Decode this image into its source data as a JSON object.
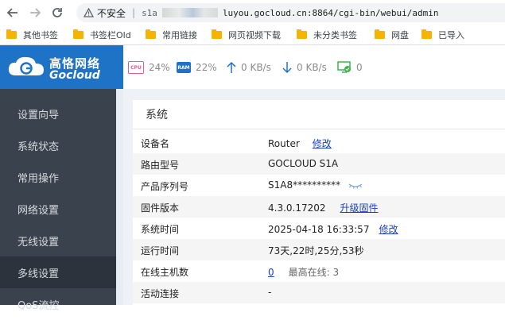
{
  "browser": {
    "back_icon": "back-arrow-icon",
    "forward_icon": "forward-arrow-icon",
    "reload_icon": "reload-icon",
    "insecure_label": "不安全",
    "separator": "|",
    "url_prefix": "s1a",
    "url": "luyou.gocloud.cn:8864/cgi-bin/webui/admin"
  },
  "bookmarks": [
    "其他书签",
    "书签栏Old",
    "常用链接",
    "网页视频下载",
    "未分类书签",
    "网盘",
    "已导入"
  ],
  "header": {
    "logo_cn": "高恪网络",
    "logo_en": "Gocloud",
    "cpu_chip": "CPU",
    "cpu": "24%",
    "ram_chip": "RAM",
    "ram": "22%",
    "upload": "0 KB/s",
    "download": "0 KB/s",
    "monitor": "0"
  },
  "sidebar": {
    "items": [
      {
        "label": "设置向导"
      },
      {
        "label": "系统状态"
      },
      {
        "label": "常用操作"
      },
      {
        "label": "网络设置"
      },
      {
        "label": "无线设置"
      },
      {
        "label": "多线设置",
        "active": true
      },
      {
        "label": "QoS流控"
      }
    ]
  },
  "panel": {
    "title": "系统",
    "rows": [
      {
        "label": "设备名",
        "value": "Router",
        "action": "修改"
      },
      {
        "label": "路由型号",
        "value": "GOCLOUD S1A"
      },
      {
        "label": "产品序列号",
        "value": "S1A8**********"
      },
      {
        "label": "固件版本",
        "value": "4.3.0.17202",
        "action": "升级固件"
      },
      {
        "label": "系统时间",
        "value": "2025-04-18 16:33:57",
        "action": "修改"
      },
      {
        "label": "运行时间",
        "value": "73天,22时,25分,53秒"
      },
      {
        "label": "在线主机数",
        "value": "0",
        "extra": "最高在线: 3"
      },
      {
        "label": "活动连接",
        "value": "-"
      }
    ]
  },
  "colors": {
    "brand": "#1f73c7",
    "sidebar": "#3a424d",
    "link": "#1a3fc7",
    "cpu": "#e85a8b",
    "ram": "#1f73c7",
    "ok": "#3bb54a"
  }
}
